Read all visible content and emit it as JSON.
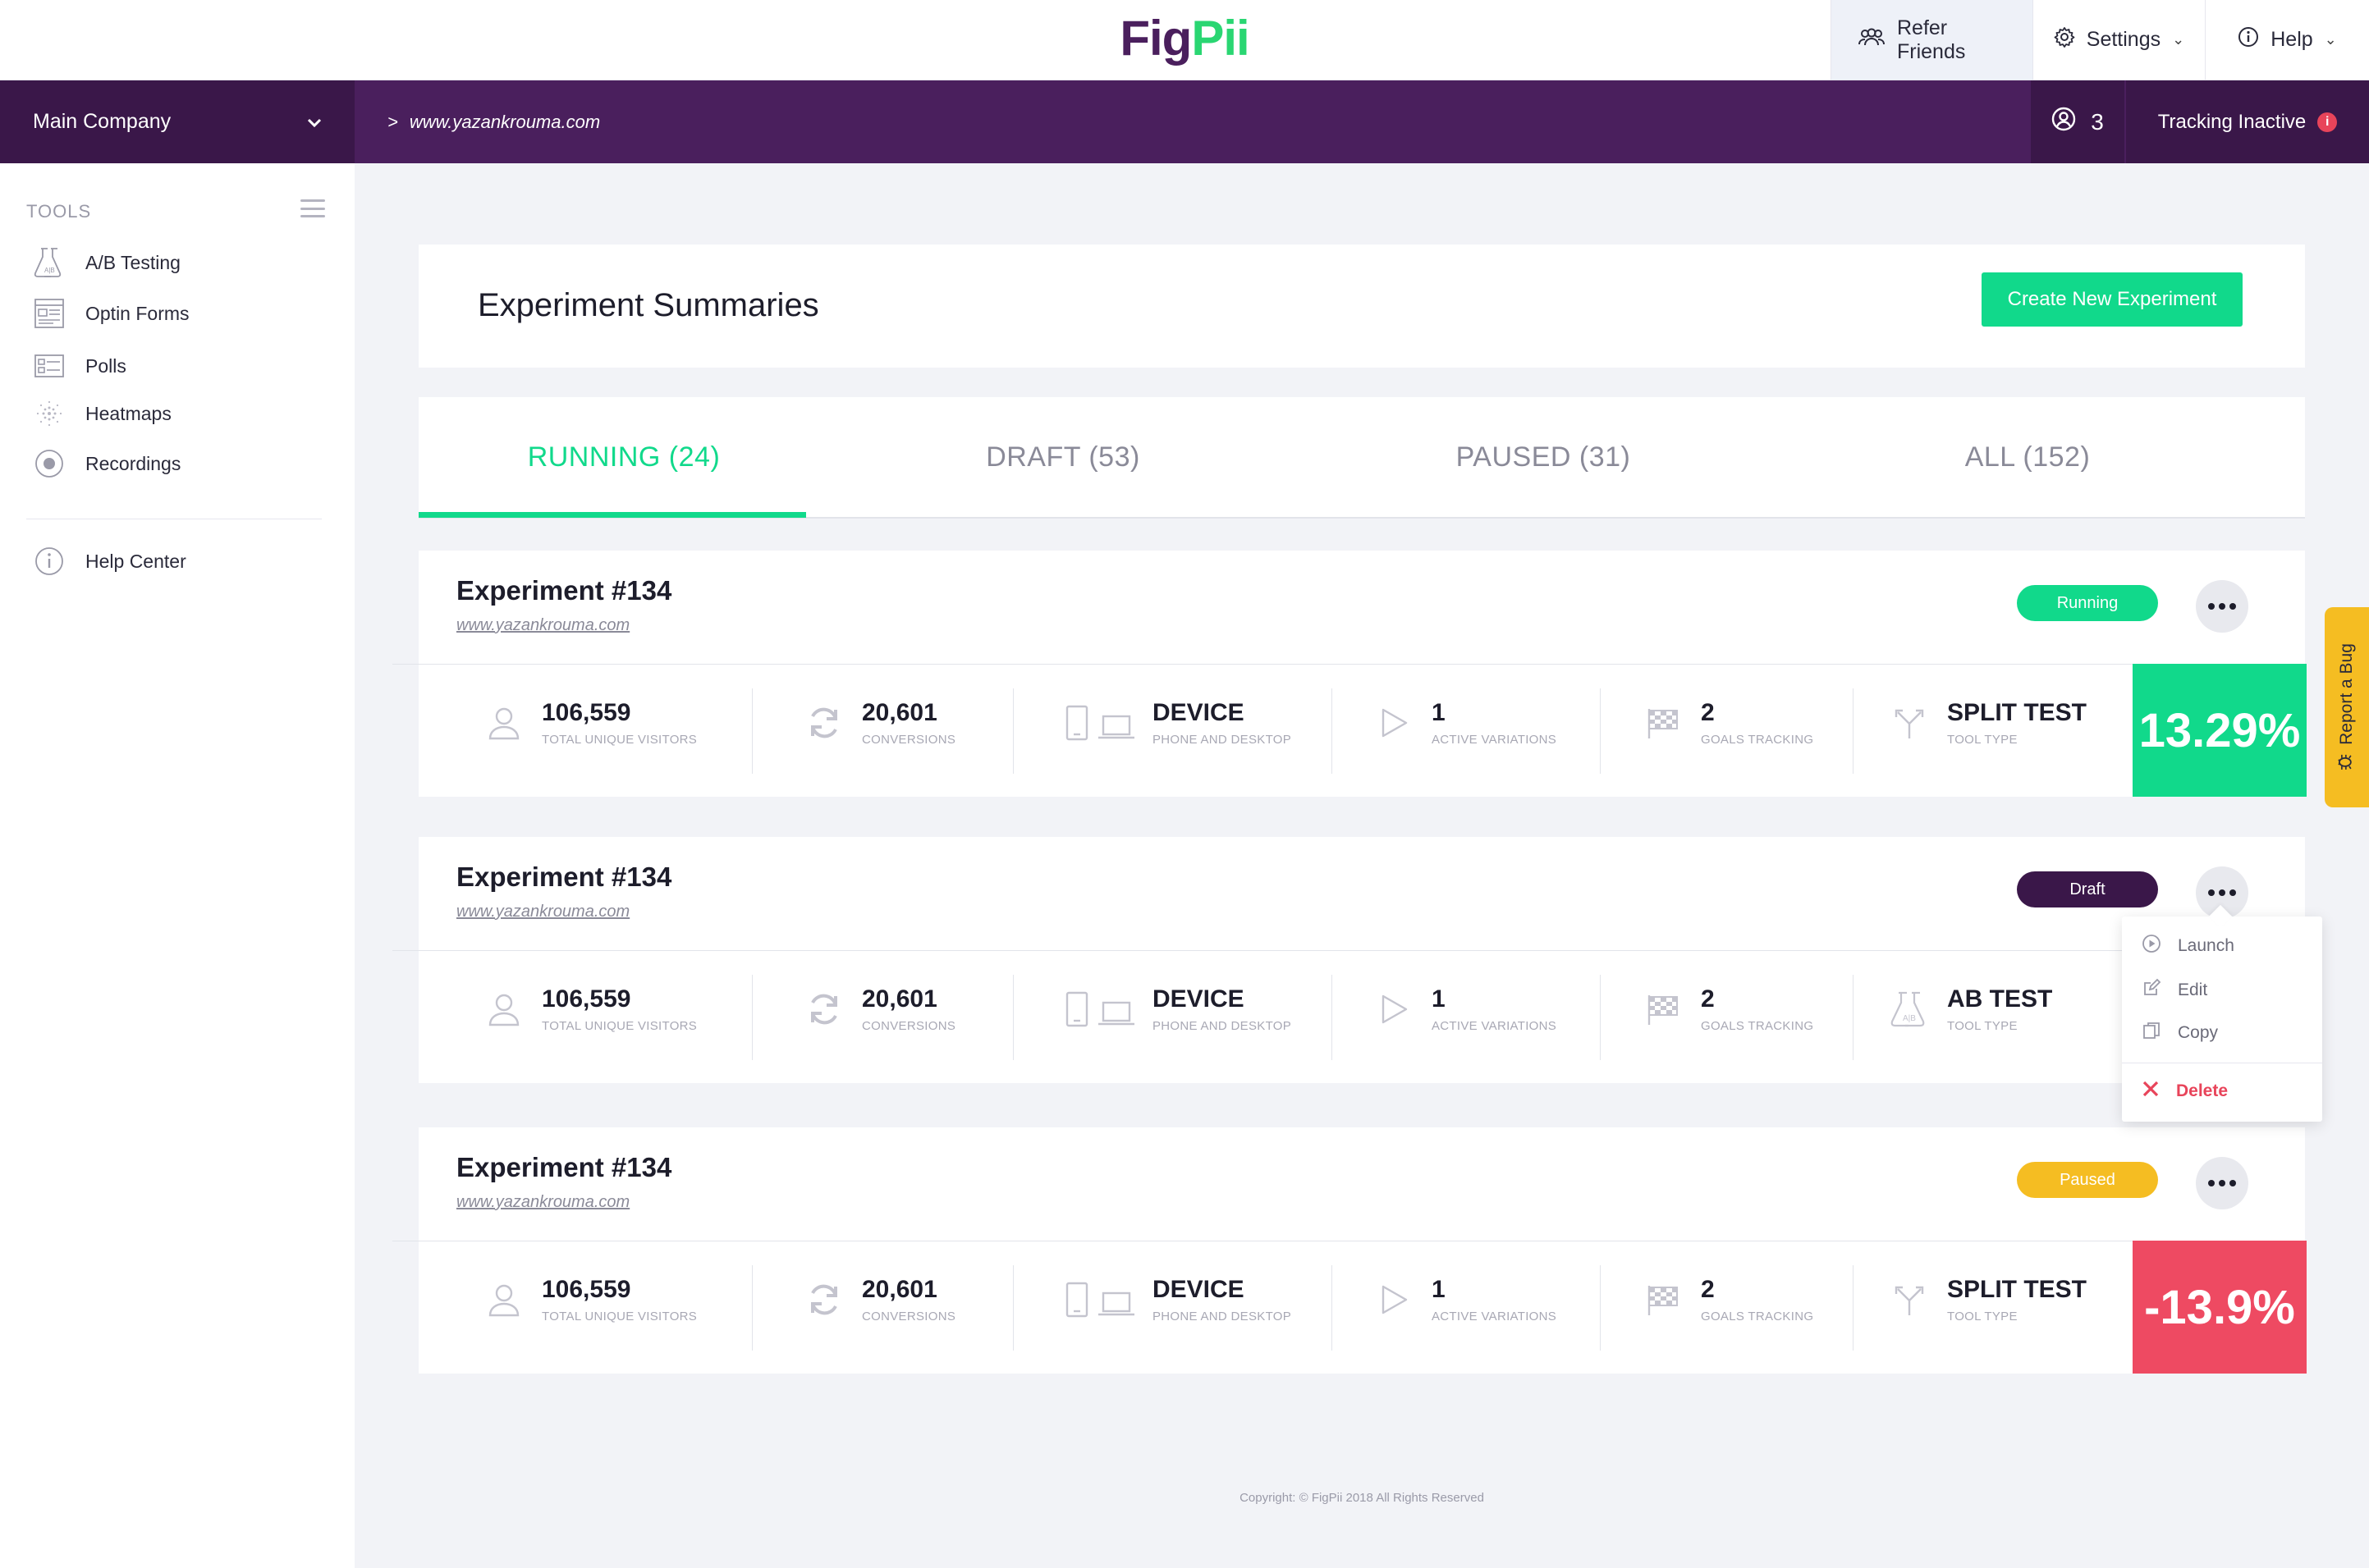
{
  "brand": {
    "logo_part1": "Fig",
    "logo_part2": "Pii",
    "primary_color": "#4a1f5d",
    "accent_color": "#11d98b"
  },
  "topnav": {
    "refer_label": "Refer Friends",
    "settings_label": "Settings",
    "help_label": "Help"
  },
  "header": {
    "company": "Main Company",
    "breadcrumb_sep": ">",
    "breadcrumb_url": "www.yazankrouma.com",
    "users_count": "3",
    "tracking_status": "Tracking Inactive"
  },
  "sidebar": {
    "tools_heading": "TOOLS",
    "items": [
      {
        "label": "A/B Testing",
        "icon": "flask-icon"
      },
      {
        "label": "Optin Forms",
        "icon": "form-icon"
      },
      {
        "label": "Polls",
        "icon": "poll-icon"
      },
      {
        "label": "Heatmaps",
        "icon": "heatmap-icon"
      },
      {
        "label": "Recordings",
        "icon": "record-icon"
      }
    ],
    "help_label": "Help Center"
  },
  "page": {
    "title": "Experiment Summaries",
    "create_button": "Create New Experiment"
  },
  "tabs": [
    {
      "label": "RUNNING (24)",
      "active": true
    },
    {
      "label": "DRAFT (53)",
      "active": false
    },
    {
      "label": "PAUSED (31)",
      "active": false
    },
    {
      "label": "ALL (152)",
      "active": false
    }
  ],
  "metric_labels": {
    "visitors": "TOTAL UNIQUE VISITORS",
    "conversions": "CONVERSIONS",
    "device": "PHONE AND DESKTOP",
    "variations": "ACTIVE VARIATIONS",
    "goals": "GOALS TRACKING",
    "tool": "TOOL TYPE"
  },
  "experiments": [
    {
      "name": "Experiment #134",
      "url": "www.yazankrouma.com",
      "status": "Running",
      "status_color": "#11d98b",
      "visitors": "106,559",
      "conversions": "20,601",
      "device": "DEVICE",
      "variations": "1",
      "goals": "2",
      "tool": "SPLIT TEST",
      "change": "13.29%",
      "change_color": "#11d98b"
    },
    {
      "name": "Experiment #134",
      "url": "www.yazankrouma.com",
      "status": "Draft",
      "status_color": "#3a1749",
      "visitors": "106,559",
      "conversions": "20,601",
      "device": "DEVICE",
      "variations": "1",
      "goals": "2",
      "tool": "AB TEST"
    },
    {
      "name": "Experiment #134",
      "url": "www.yazankrouma.com",
      "status": "Paused",
      "status_color": "#f5bd22",
      "visitors": "106,559",
      "conversions": "20,601",
      "device": "DEVICE",
      "variations": "1",
      "goals": "2",
      "tool": "SPLIT TEST",
      "change": "-13.9%",
      "change_color": "#ee4a62"
    }
  ],
  "dropdown": {
    "launch": "Launch",
    "edit": "Edit",
    "copy": "Copy",
    "delete": "Delete"
  },
  "report_bug": "Report a Bug",
  "footer": "Copyright: © FigPii 2018 All Rights Reserved"
}
